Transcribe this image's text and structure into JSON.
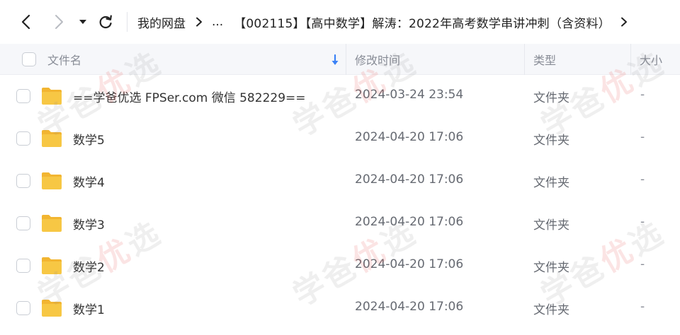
{
  "toolbar": {
    "back_icon": "chevron-left-icon",
    "forward_icon": "chevron-right-icon",
    "dropdown_icon": "caret-down-icon",
    "refresh_icon": "refresh-icon"
  },
  "breadcrumb": {
    "root": "我的网盘",
    "ellipsis": "...",
    "current": "【002115】【高中数学】解涛：2022年高考数学串讲冲刺（含资料）",
    "separator_icon": "chevron-right-icon"
  },
  "table": {
    "columns": {
      "name": "文件名",
      "modified": "修改时间",
      "type": "类型",
      "size": "大小"
    },
    "sort_icon": "arrow-down-sort-icon",
    "rows": [
      {
        "name": "==学爸优选 FPSer.com 微信 582229==",
        "modified": "2024-03-24 23:54",
        "type": "文件夹",
        "size": "-"
      },
      {
        "name": "数学5",
        "modified": "2024-04-20 17:06",
        "type": "文件夹",
        "size": "-"
      },
      {
        "name": "数学4",
        "modified": "2024-04-20 17:06",
        "type": "文件夹",
        "size": "-"
      },
      {
        "name": "数学3",
        "modified": "2024-04-20 17:06",
        "type": "文件夹",
        "size": "-"
      },
      {
        "name": "数学2",
        "modified": "2024-04-20 17:06",
        "type": "文件夹",
        "size": "-"
      },
      {
        "name": "数学1",
        "modified": "2024-04-20 17:06",
        "type": "文件夹",
        "size": "-"
      }
    ]
  },
  "watermark": {
    "part1": "学爸",
    "part2": "优",
    "part3": "选"
  },
  "colors": {
    "folder": "#f7c744",
    "folder_tab": "#f2b531",
    "sort_arrow": "#3b82f6",
    "header_bg": "#f6f7fa"
  }
}
